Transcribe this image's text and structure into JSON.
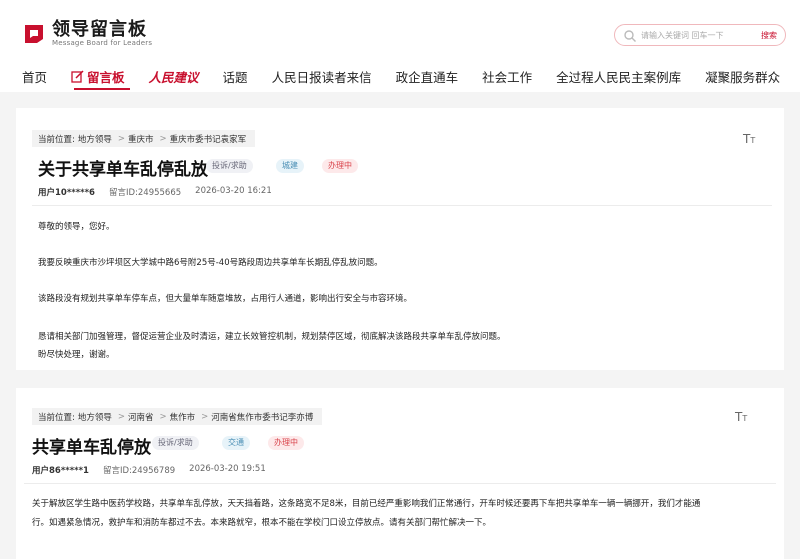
{
  "header": {
    "logo_title": "领导留言板",
    "logo_subtitle": "Message Board for Leaders",
    "search_placeholder": "请输入关键词 回车一下",
    "search_button": "搜索",
    "accent": "#c8102e"
  },
  "nav": {
    "items": [
      {
        "label": "首页",
        "icon": ""
      },
      {
        "label": "留言板",
        "icon": "edit-icon"
      },
      {
        "label": "人民建议",
        "icon": ""
      },
      {
        "label": "话题",
        "icon": ""
      },
      {
        "label": "人民日报读者来信",
        "icon": ""
      },
      {
        "label": "政企直通车",
        "icon": ""
      },
      {
        "label": "社会工作",
        "icon": ""
      },
      {
        "label": "全过程人民民主案例库",
        "icon": ""
      },
      {
        "label": "凝聚服务群众",
        "icon": ""
      }
    ]
  },
  "posts": [
    {
      "breadcrumb": [
        "当前位置:",
        "地方领导",
        ">",
        "重庆市",
        ">",
        "重庆市委书记袁家军"
      ],
      "title": "关于共享单车乱停乱放",
      "tags": {
        "type": "投诉/求助",
        "category": "城建",
        "status": "办理中"
      },
      "user": "用户10*****6",
      "message_id": "留言ID:24955665",
      "time": "2026-03-20 16:21",
      "body": [
        "尊敬的领导，您好。",
        "我要反映重庆市沙坪坝区大学城中路6号附25号-40号路段周边共享单车长期乱停乱放问题。",
        "该路段没有规划共享单车停车点，但大量单车随意堆放，占用行人通道，影响出行安全与市容环境。",
        "恳请相关部门加强管理，督促运营企业及时清运，建立长效管控机制，规划禁停区域，彻底解决该路段共享单车乱停放问题。",
        "盼尽快处理，谢谢。"
      ]
    },
    {
      "breadcrumb": [
        "当前位置:",
        "地方领导",
        ">",
        "河南省",
        ">",
        "焦作市",
        ">",
        "河南省焦作市委书记李亦博"
      ],
      "title": "共享单车乱停放",
      "tags": {
        "type": "投诉/求助",
        "category": "交通",
        "status": "办理中"
      },
      "user": "用户86*****1",
      "message_id": "留言ID:24956789",
      "time": "2026-03-20 19:51",
      "body": [
        "关于解放区学生路中医药学校路，共享单车乱停放，天天挡着路，这条路宽不足8米，目前已经严重影响我们正常通行，开车时候还要再下车把共享单车一辆一辆挪开，我们才能通",
        "行。如遇紧急情况，救护车和消防车都过不去。本来路就窄，根本不能在学校门口设立停放点。请有关部门帮忙解决一下。"
      ]
    }
  ]
}
